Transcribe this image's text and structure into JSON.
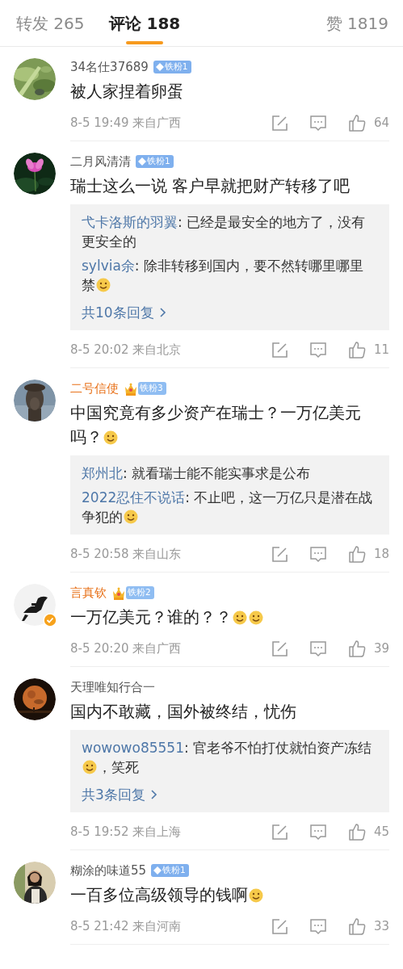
{
  "tabs": [
    {
      "label": "转发 265",
      "selected": false
    },
    {
      "label": "评论 188",
      "selected": true
    },
    {
      "label": "赞 1819",
      "selected": false
    }
  ],
  "comments": [
    {
      "user": "34名仕37689",
      "vip": false,
      "verified": false,
      "badge": {
        "kind": "diamond",
        "label": "铁粉1"
      },
      "content": [
        {
          "kind": "text",
          "text": "被人家捏着卵蛋"
        }
      ],
      "time": "8-5 19:49",
      "location": "来自广西",
      "likes": "64"
    },
    {
      "user": "二月风清清",
      "vip": false,
      "verified": false,
      "badge": {
        "kind": "diamond",
        "label": "铁粉1"
      },
      "content": [
        {
          "kind": "text",
          "text": "瑞士这么一说 客户早就把财产转移了吧"
        }
      ],
      "replies": [
        {
          "author": "弋卡洛斯的羽翼",
          "content": [
            {
              "kind": "text",
              "text": ": 已经是最安全的地方了，没有更安全的"
            }
          ]
        },
        {
          "author": "sylvia余",
          "content": [
            {
              "kind": "text",
              "text": ": 除非转移到国内，要不然转哪里哪里禁"
            },
            {
              "kind": "emoji"
            }
          ]
        }
      ],
      "more_replies": "共10条回复",
      "time": "8-5 20:02",
      "location": "来自北京",
      "likes": "11"
    },
    {
      "user": "二号信使",
      "vip": true,
      "verified": false,
      "badge": {
        "kind": "crown",
        "label": "铁粉3"
      },
      "content": [
        {
          "kind": "text",
          "text": "中国究竟有多少资产在瑞士？一万亿美元吗？"
        },
        {
          "kind": "emoji"
        }
      ],
      "replies": [
        {
          "author": "郑州北",
          "content": [
            {
              "kind": "text",
              "text": ": 就看瑞士能不能实事求是公布"
            }
          ]
        },
        {
          "author": "2022忍住不说话",
          "content": [
            {
              "kind": "text",
              "text": ": 不止吧，这一万亿只是潜在战争犯的"
            },
            {
              "kind": "emoji"
            }
          ]
        }
      ],
      "time": "8-5 20:58",
      "location": "来自山东",
      "likes": "18"
    },
    {
      "user": "言真钦",
      "vip": true,
      "verified": true,
      "badge": {
        "kind": "crown",
        "label": "铁粉2"
      },
      "content": [
        {
          "kind": "text",
          "text": "一万亿美元？谁的？？"
        },
        {
          "kind": "emoji"
        },
        {
          "kind": "emoji"
        }
      ],
      "time": "8-5 20:20",
      "location": "来自广西",
      "likes": "39"
    },
    {
      "user": "天理唯知行合一",
      "vip": false,
      "verified": false,
      "content": [
        {
          "kind": "text",
          "text": "国内不敢藏，国外被终结，忧伤"
        }
      ],
      "replies": [
        {
          "author": "wowowo85551",
          "content": [
            {
              "kind": "text",
              "text": ": 官老爷不怕打仗就怕资产冻结"
            },
            {
              "kind": "emoji"
            },
            {
              "kind": "text",
              "text": "，笑死"
            }
          ]
        }
      ],
      "more_replies": "共3条回复",
      "time": "8-5 19:52",
      "location": "来自上海",
      "likes": "45"
    },
    {
      "user": "糊涂的味道55",
      "vip": false,
      "verified": false,
      "badge": {
        "kind": "diamond",
        "label": "铁粉1"
      },
      "content": [
        {
          "kind": "text",
          "text": "一百多位高级领导的钱啊"
        },
        {
          "kind": "emoji"
        }
      ],
      "time": "8-5 21:42",
      "location": "来自河南",
      "likes": "33"
    }
  ]
}
